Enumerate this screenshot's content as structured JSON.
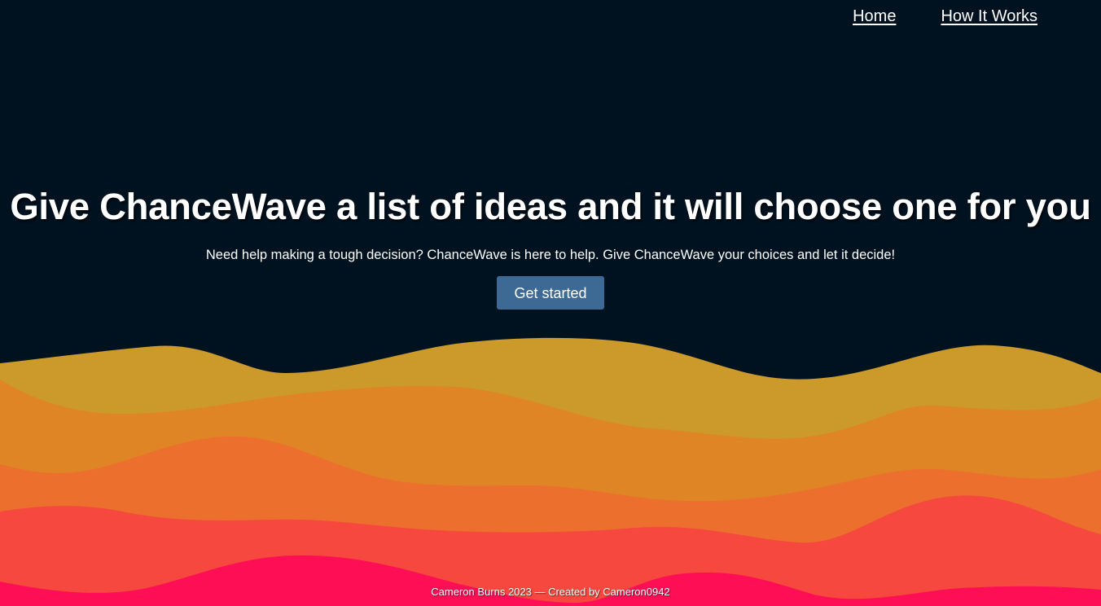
{
  "nav": {
    "home_label": "Home",
    "how_it_works_label": "How It Works"
  },
  "hero": {
    "title": "Give ChanceWave a list of ideas and it will choose one for you",
    "subtitle": "Need help making a tough decision? ChanceWave is here to help. Give ChanceWave your choices and let it decide!",
    "cta_label": "Get started"
  },
  "footer": {
    "credit": "Cameron Burns 2023 — ",
    "created_by": "Created by Cameron0942"
  },
  "colors": {
    "background": "#001220",
    "wave_1": "#cc9a2b",
    "wave_2": "#df8526",
    "wave_3": "#ec6f2e",
    "wave_4": "#f6483e",
    "wave_5": "#fe0f55",
    "button": "#3d6a94"
  }
}
